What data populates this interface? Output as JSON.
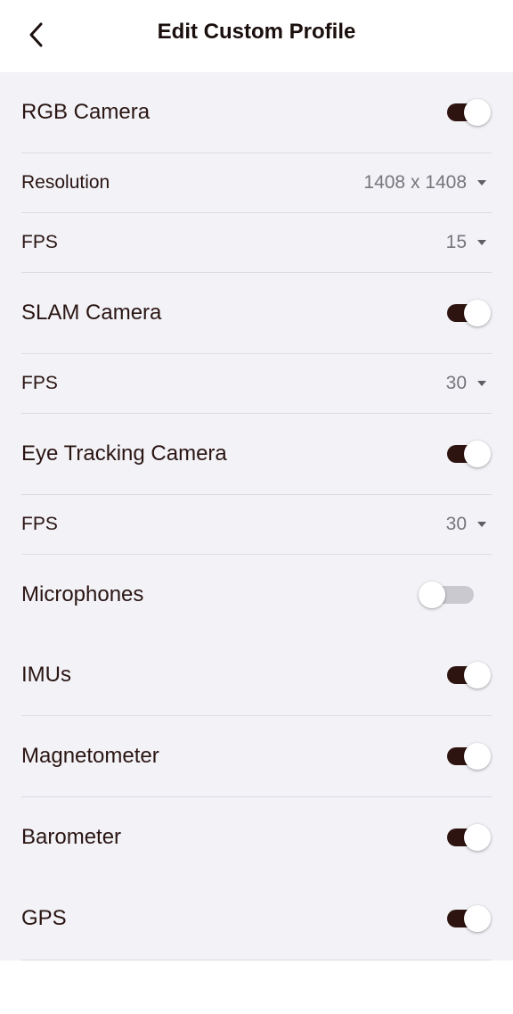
{
  "header": {
    "title": "Edit Custom Profile",
    "back_icon": "chevron-left-icon"
  },
  "colors": {
    "toggle_on": "#2e1410",
    "toggle_off": "#c9c9cf",
    "content_bg": "#f2f2f7",
    "text": "#2a1512",
    "secondary_text": "#76767c"
  },
  "settings": {
    "rgb_camera": {
      "label": "RGB Camera",
      "enabled": true,
      "resolution": {
        "label": "Resolution",
        "value": "1408 x 1408"
      },
      "fps": {
        "label": "FPS",
        "value": "15"
      }
    },
    "slam_camera": {
      "label": "SLAM Camera",
      "enabled": true,
      "fps": {
        "label": "FPS",
        "value": "30"
      }
    },
    "eye_tracking_camera": {
      "label": "Eye Tracking Camera",
      "enabled": true,
      "fps": {
        "label": "FPS",
        "value": "30"
      }
    },
    "microphones": {
      "label": "Microphones",
      "enabled": false
    },
    "imus": {
      "label": "IMUs",
      "enabled": true
    },
    "magnetometer": {
      "label": "Magnetometer",
      "enabled": true
    },
    "barometer": {
      "label": "Barometer",
      "enabled": true
    },
    "gps": {
      "label": "GPS",
      "enabled": true
    }
  }
}
